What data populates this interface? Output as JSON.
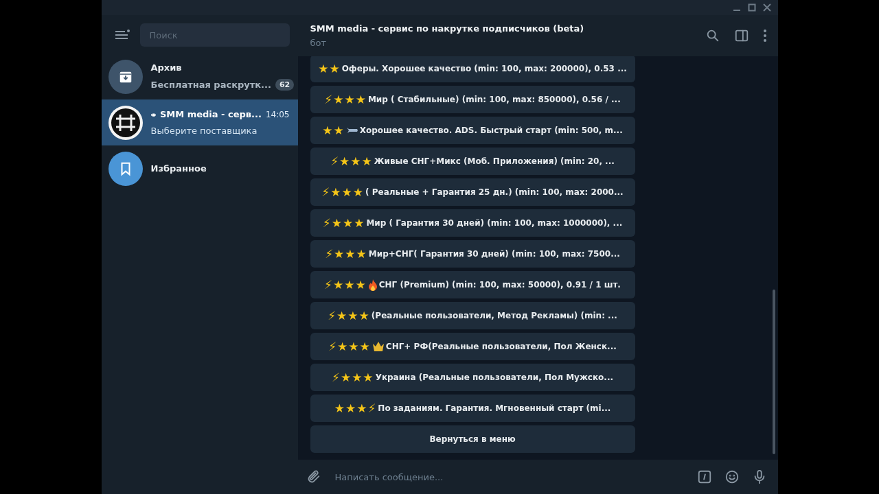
{
  "window": {
    "controls": [
      {
        "kind": "minimize"
      },
      {
        "kind": "maximize"
      },
      {
        "kind": "close"
      }
    ]
  },
  "sidebar": {
    "search": {
      "placeholder": "Поиск"
    },
    "chats": [
      {
        "kind": "archive",
        "name": "Архив",
        "preview": "Бесплатная раскрутк...",
        "unread": "62",
        "selected": false
      },
      {
        "kind": "bot",
        "name": "SMM media - серв...",
        "time": "14:05",
        "preview": "Выберите поставщика",
        "selected": true
      },
      {
        "kind": "saved",
        "name": "Избранное",
        "selected": false
      }
    ]
  },
  "chat": {
    "title": "SMM media - сервис по накрутке подписчиков (beta)",
    "subtitle": "бот",
    "buttons": [
      {
        "prefix": "★★",
        "label": "Оферы. Хорошее качество (min: 100, max: 200000), 0.53 ..."
      },
      {
        "prefix": "⚡★★★",
        "label": "Мир ( Стабильные) (min: 100, max: 850000), 0.56 / ..."
      },
      {
        "prefix": "★★",
        "kind": "plane",
        "label": "Хорошее качество. ADS. Быстрый старт (min: 500, m..."
      },
      {
        "prefix": "⚡★★★",
        "label": "Живые СНГ+Микс (Моб. Приложения) (min: 20, ..."
      },
      {
        "prefix": "⚡★★★",
        "label": "( Реальные + Гарантия 25 дн.) (min: 100, max: 2000..."
      },
      {
        "prefix": "⚡★★★",
        "label": "Мир ( Гарантия 30 дней) (min: 100, max: 1000000), ..."
      },
      {
        "prefix": "⚡★★★",
        "label": "Мир+СНГ( Гарантия 30 дней) (min: 100, max: 7500..."
      },
      {
        "prefix": "⚡★★★",
        "kind": "fire",
        "label": "СНГ (Premium) (min: 100, max: 50000), 0.91 / 1 шт."
      },
      {
        "prefix": "⚡★★★",
        "label": "(Реальные пользователи, Метод Рекламы) (min: ..."
      },
      {
        "prefix": "⚡★★★",
        "kind": "crown",
        "label": "СНГ+ РФ(Реальные пользователи, Пол Женск..."
      },
      {
        "prefix": "⚡★★★",
        "label": "Украина (Реальные пользователи, Пол Мужско..."
      },
      {
        "prefix": "★★★⚡",
        "label": "По заданиям. Гарантия. Мгновенный старт (mi..."
      },
      {
        "label": "Вернуться в меню"
      }
    ],
    "composer": {
      "placeholder": "Написать сообщение..."
    }
  }
}
